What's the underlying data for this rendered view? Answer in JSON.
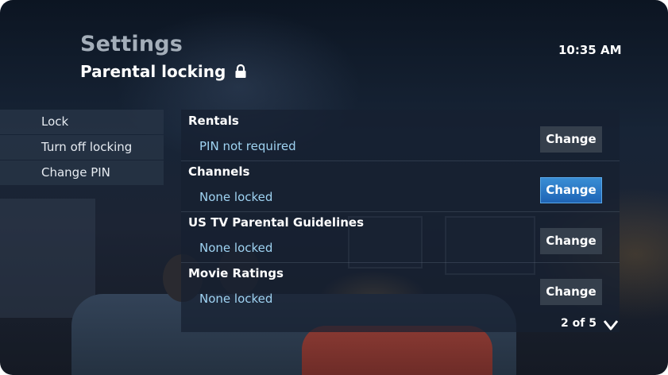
{
  "header": {
    "app_title": "Settings",
    "section_title": "Parental locking",
    "section_icon": "lock-icon",
    "time": "10:35 AM"
  },
  "menu": {
    "items": [
      {
        "label": "Lock"
      },
      {
        "label": "Turn off locking"
      },
      {
        "label": "Change PIN"
      }
    ]
  },
  "settings": {
    "rows": [
      {
        "title": "Rentals",
        "value": "PIN not required",
        "button": "Change",
        "focused": false
      },
      {
        "title": "Channels",
        "value": "None locked",
        "button": "Change",
        "focused": true
      },
      {
        "title": "US TV Parental Guidelines",
        "value": "None locked",
        "button": "Change",
        "focused": false
      },
      {
        "title": "Movie Ratings",
        "value": "None locked",
        "button": "Change",
        "focused": false
      }
    ]
  },
  "pager": {
    "text": "2 of 5",
    "icon": "chevron-down-icon"
  },
  "colors": {
    "accent": "#2a7ccb",
    "value_text": "#9fd3f2"
  }
}
